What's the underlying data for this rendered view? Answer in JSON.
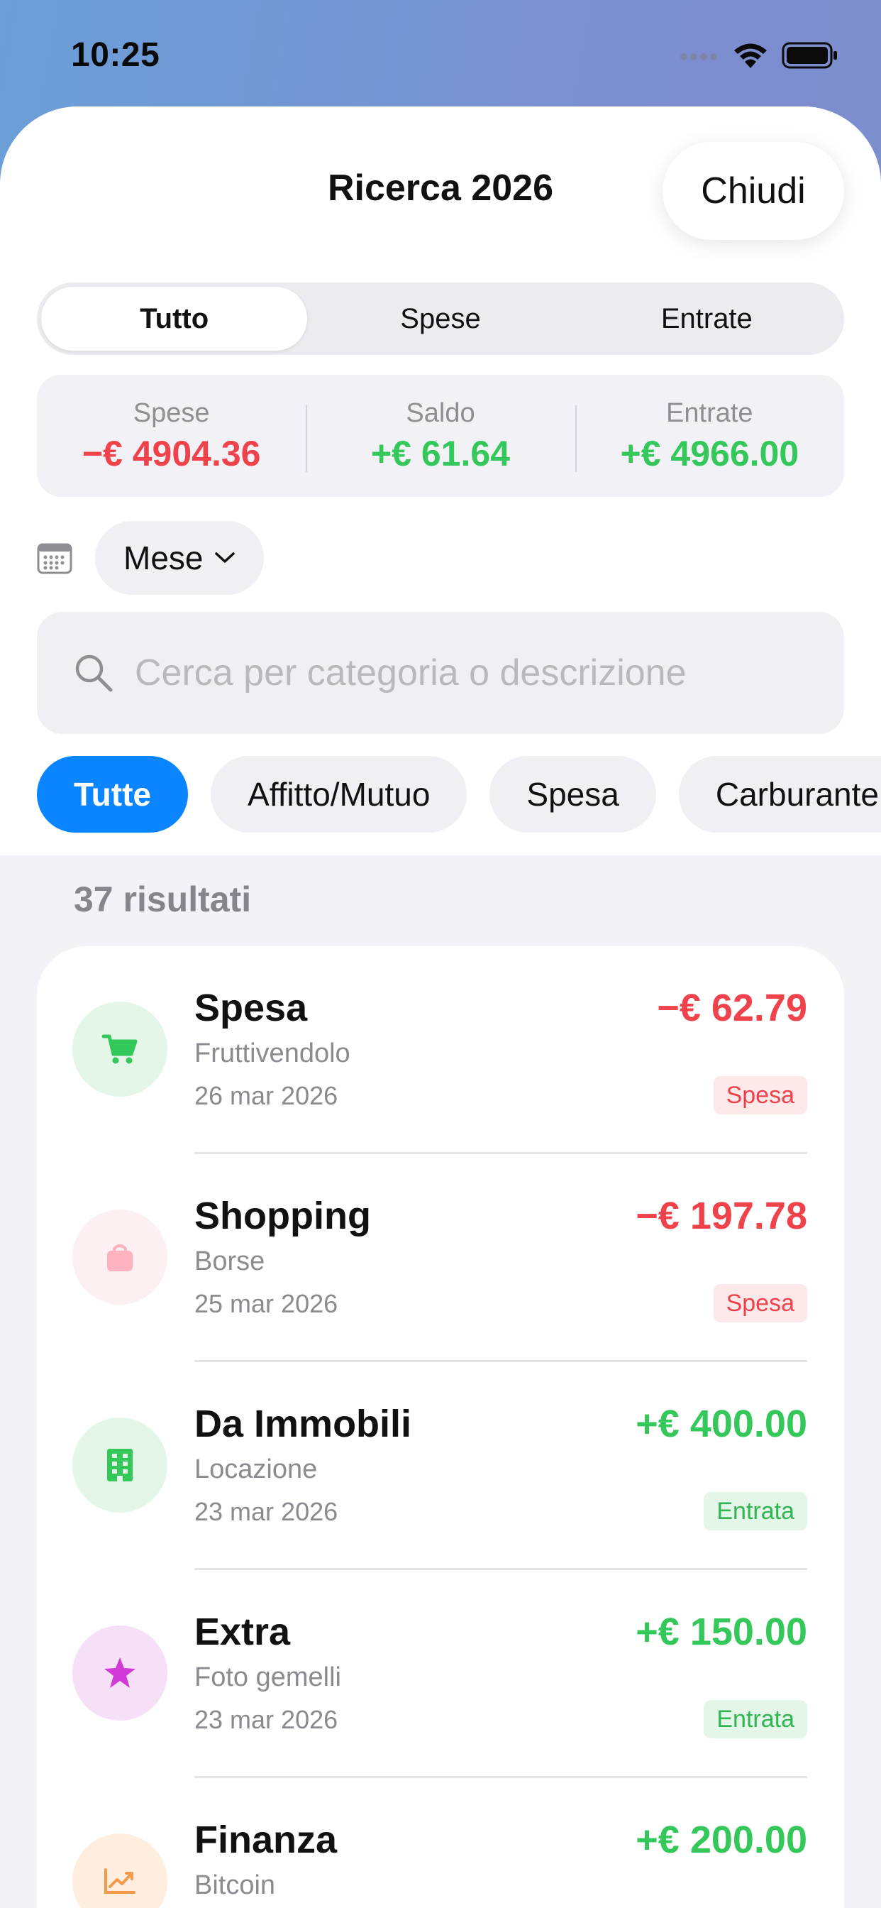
{
  "status": {
    "time": "10:25"
  },
  "header": {
    "title": "Ricerca 2026",
    "close_label": "Chiudi"
  },
  "segments": [
    {
      "label": "Tutto",
      "active": true
    },
    {
      "label": "Spese",
      "active": false
    },
    {
      "label": "Entrate",
      "active": false
    }
  ],
  "summary": {
    "expenses_label": "Spese",
    "expenses_value": "−€ 4904.36",
    "balance_label": "Saldo",
    "balance_value": "+€ 61.64",
    "income_label": "Entrate",
    "income_value": "+€ 4966.00"
  },
  "period": {
    "label": "Mese"
  },
  "search": {
    "placeholder": "Cerca per categoria o descrizione"
  },
  "chips": [
    {
      "label": "Tutte",
      "active": true
    },
    {
      "label": "Affitto/Mutuo",
      "active": false
    },
    {
      "label": "Spesa",
      "active": false
    },
    {
      "label": "Carburante",
      "active": false
    }
  ],
  "results": {
    "count_label": "37 risultati",
    "items": [
      {
        "category": "Spesa",
        "description": "Fruttivendolo",
        "date": "26 mar 2026",
        "amount": "−€ 62.79",
        "badge": "Spesa",
        "kind": "expense",
        "icon": "cart-icon",
        "icon_color": "#34c759",
        "icon_bg": "#e3f6e8"
      },
      {
        "category": "Shopping",
        "description": "Borse",
        "date": "25 mar 2026",
        "amount": "−€ 197.78",
        "badge": "Spesa",
        "kind": "expense",
        "icon": "bag-icon",
        "icon_color": "#ffb3c0",
        "icon_bg": "#fdf0f2"
      },
      {
        "category": "Da Immobili",
        "description": "Locazione",
        "date": "23 mar 2026",
        "amount": "+€ 400.00",
        "badge": "Entrata",
        "kind": "income",
        "icon": "building-icon",
        "icon_color": "#34c759",
        "icon_bg": "#e3f6e8"
      },
      {
        "category": "Extra",
        "description": "Foto gemelli",
        "date": "23 mar 2026",
        "amount": "+€ 150.00",
        "badge": "Entrata",
        "kind": "income",
        "icon": "star-icon",
        "icon_color": "#d23ad8",
        "icon_bg": "#f6e0f7"
      },
      {
        "category": "Finanza",
        "description": "Bitcoin",
        "date": "",
        "amount": "+€ 200.00",
        "badge": "",
        "kind": "income",
        "icon": "chart-up-icon",
        "icon_color": "#f2994a",
        "icon_bg": "#fdeee0"
      }
    ]
  }
}
